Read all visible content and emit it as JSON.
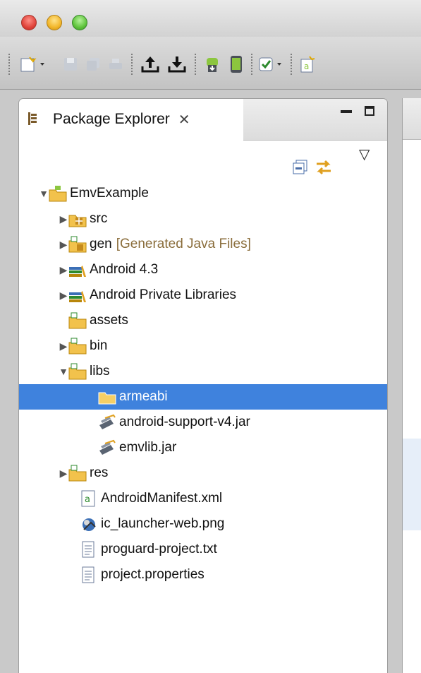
{
  "window": {
    "title_bar": ""
  },
  "toolbar": {
    "icons": [
      "new-wizard-icon",
      "save-icon",
      "save-all-icon",
      "print-icon",
      "export-upload-icon",
      "import-download-icon",
      "android-sdk-manager-icon",
      "android-avd-manager-icon",
      "checkbox-dropdown-icon",
      "new-android-project-icon"
    ]
  },
  "panel": {
    "title": "Package Explorer",
    "close_glyph": "✕",
    "minimize_glyph": "▭",
    "maximize_glyph": "□",
    "view_menu_glyph": "▽"
  },
  "tree": [
    {
      "label": "EmvExample",
      "expanded": true,
      "icon": "android-project-icon",
      "depth": 0
    },
    {
      "label": "src",
      "expanded": false,
      "icon": "source-folder-icon",
      "depth": 1
    },
    {
      "label": "gen",
      "sublabel": "[Generated Java Files]",
      "expanded": false,
      "icon": "generated-source-folder-icon",
      "depth": 1
    },
    {
      "label": "Android 4.3",
      "expanded": false,
      "icon": "library-icon",
      "depth": 1
    },
    {
      "label": "Android Private Libraries",
      "expanded": false,
      "icon": "library-icon",
      "depth": 1
    },
    {
      "label": "assets",
      "icon": "folder-icon",
      "depth": 1
    },
    {
      "label": "bin",
      "expanded": false,
      "icon": "folder-icon",
      "depth": 1
    },
    {
      "label": "libs",
      "expanded": true,
      "icon": "folder-icon",
      "depth": 1
    },
    {
      "label": "armeabi",
      "icon": "plain-folder-icon",
      "depth": 2,
      "selected": true
    },
    {
      "label": "android-support-v4.jar",
      "icon": "jar-icon",
      "depth": 2
    },
    {
      "label": "emvlib.jar",
      "icon": "jar-icon",
      "depth": 2
    },
    {
      "label": "res",
      "expanded": false,
      "icon": "folder-icon",
      "depth": 1
    },
    {
      "label": "AndroidManifest.xml",
      "icon": "manifest-file-icon",
      "depth": 1
    },
    {
      "label": "ic_launcher-web.png",
      "icon": "image-file-icon",
      "depth": 1
    },
    {
      "label": "proguard-project.txt",
      "icon": "text-file-icon",
      "depth": 1
    },
    {
      "label": "project.properties",
      "icon": "text-file-icon",
      "depth": 1
    }
  ],
  "colors": {
    "selection": "#3f82dd",
    "generated_label": "#8a6d3b",
    "folder": "#f2c24c",
    "android_green": "#8cc63f"
  }
}
